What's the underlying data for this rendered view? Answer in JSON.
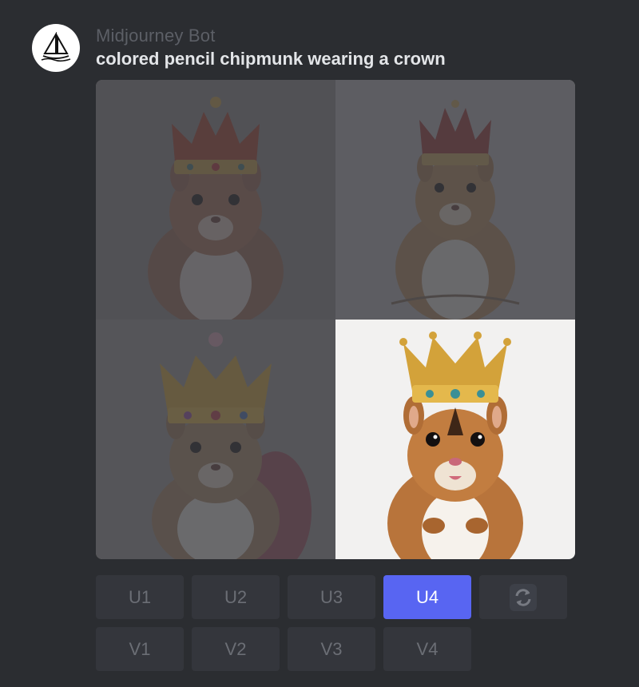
{
  "message": {
    "author": "Midjourney Bot",
    "prompt": "colored pencil chipmunk wearing a crown",
    "avatar_icon": "sailboat-logo-icon"
  },
  "image_grid": {
    "selected_index": 4,
    "images": [
      {
        "alt": "chipmunk variation 1",
        "dimmed": true
      },
      {
        "alt": "chipmunk variation 2",
        "dimmed": true
      },
      {
        "alt": "chipmunk variation 3",
        "dimmed": true
      },
      {
        "alt": "chipmunk variation 4",
        "dimmed": false
      }
    ]
  },
  "buttons": {
    "upscale": [
      "U1",
      "U2",
      "U3",
      "U4"
    ],
    "variation": [
      "V1",
      "V2",
      "V3",
      "V4"
    ],
    "reroll_icon": "reroll-icon",
    "active": "U4"
  },
  "colors": {
    "background": "#2b2d31",
    "button": "#34363c",
    "active_button": "#5865f2"
  }
}
